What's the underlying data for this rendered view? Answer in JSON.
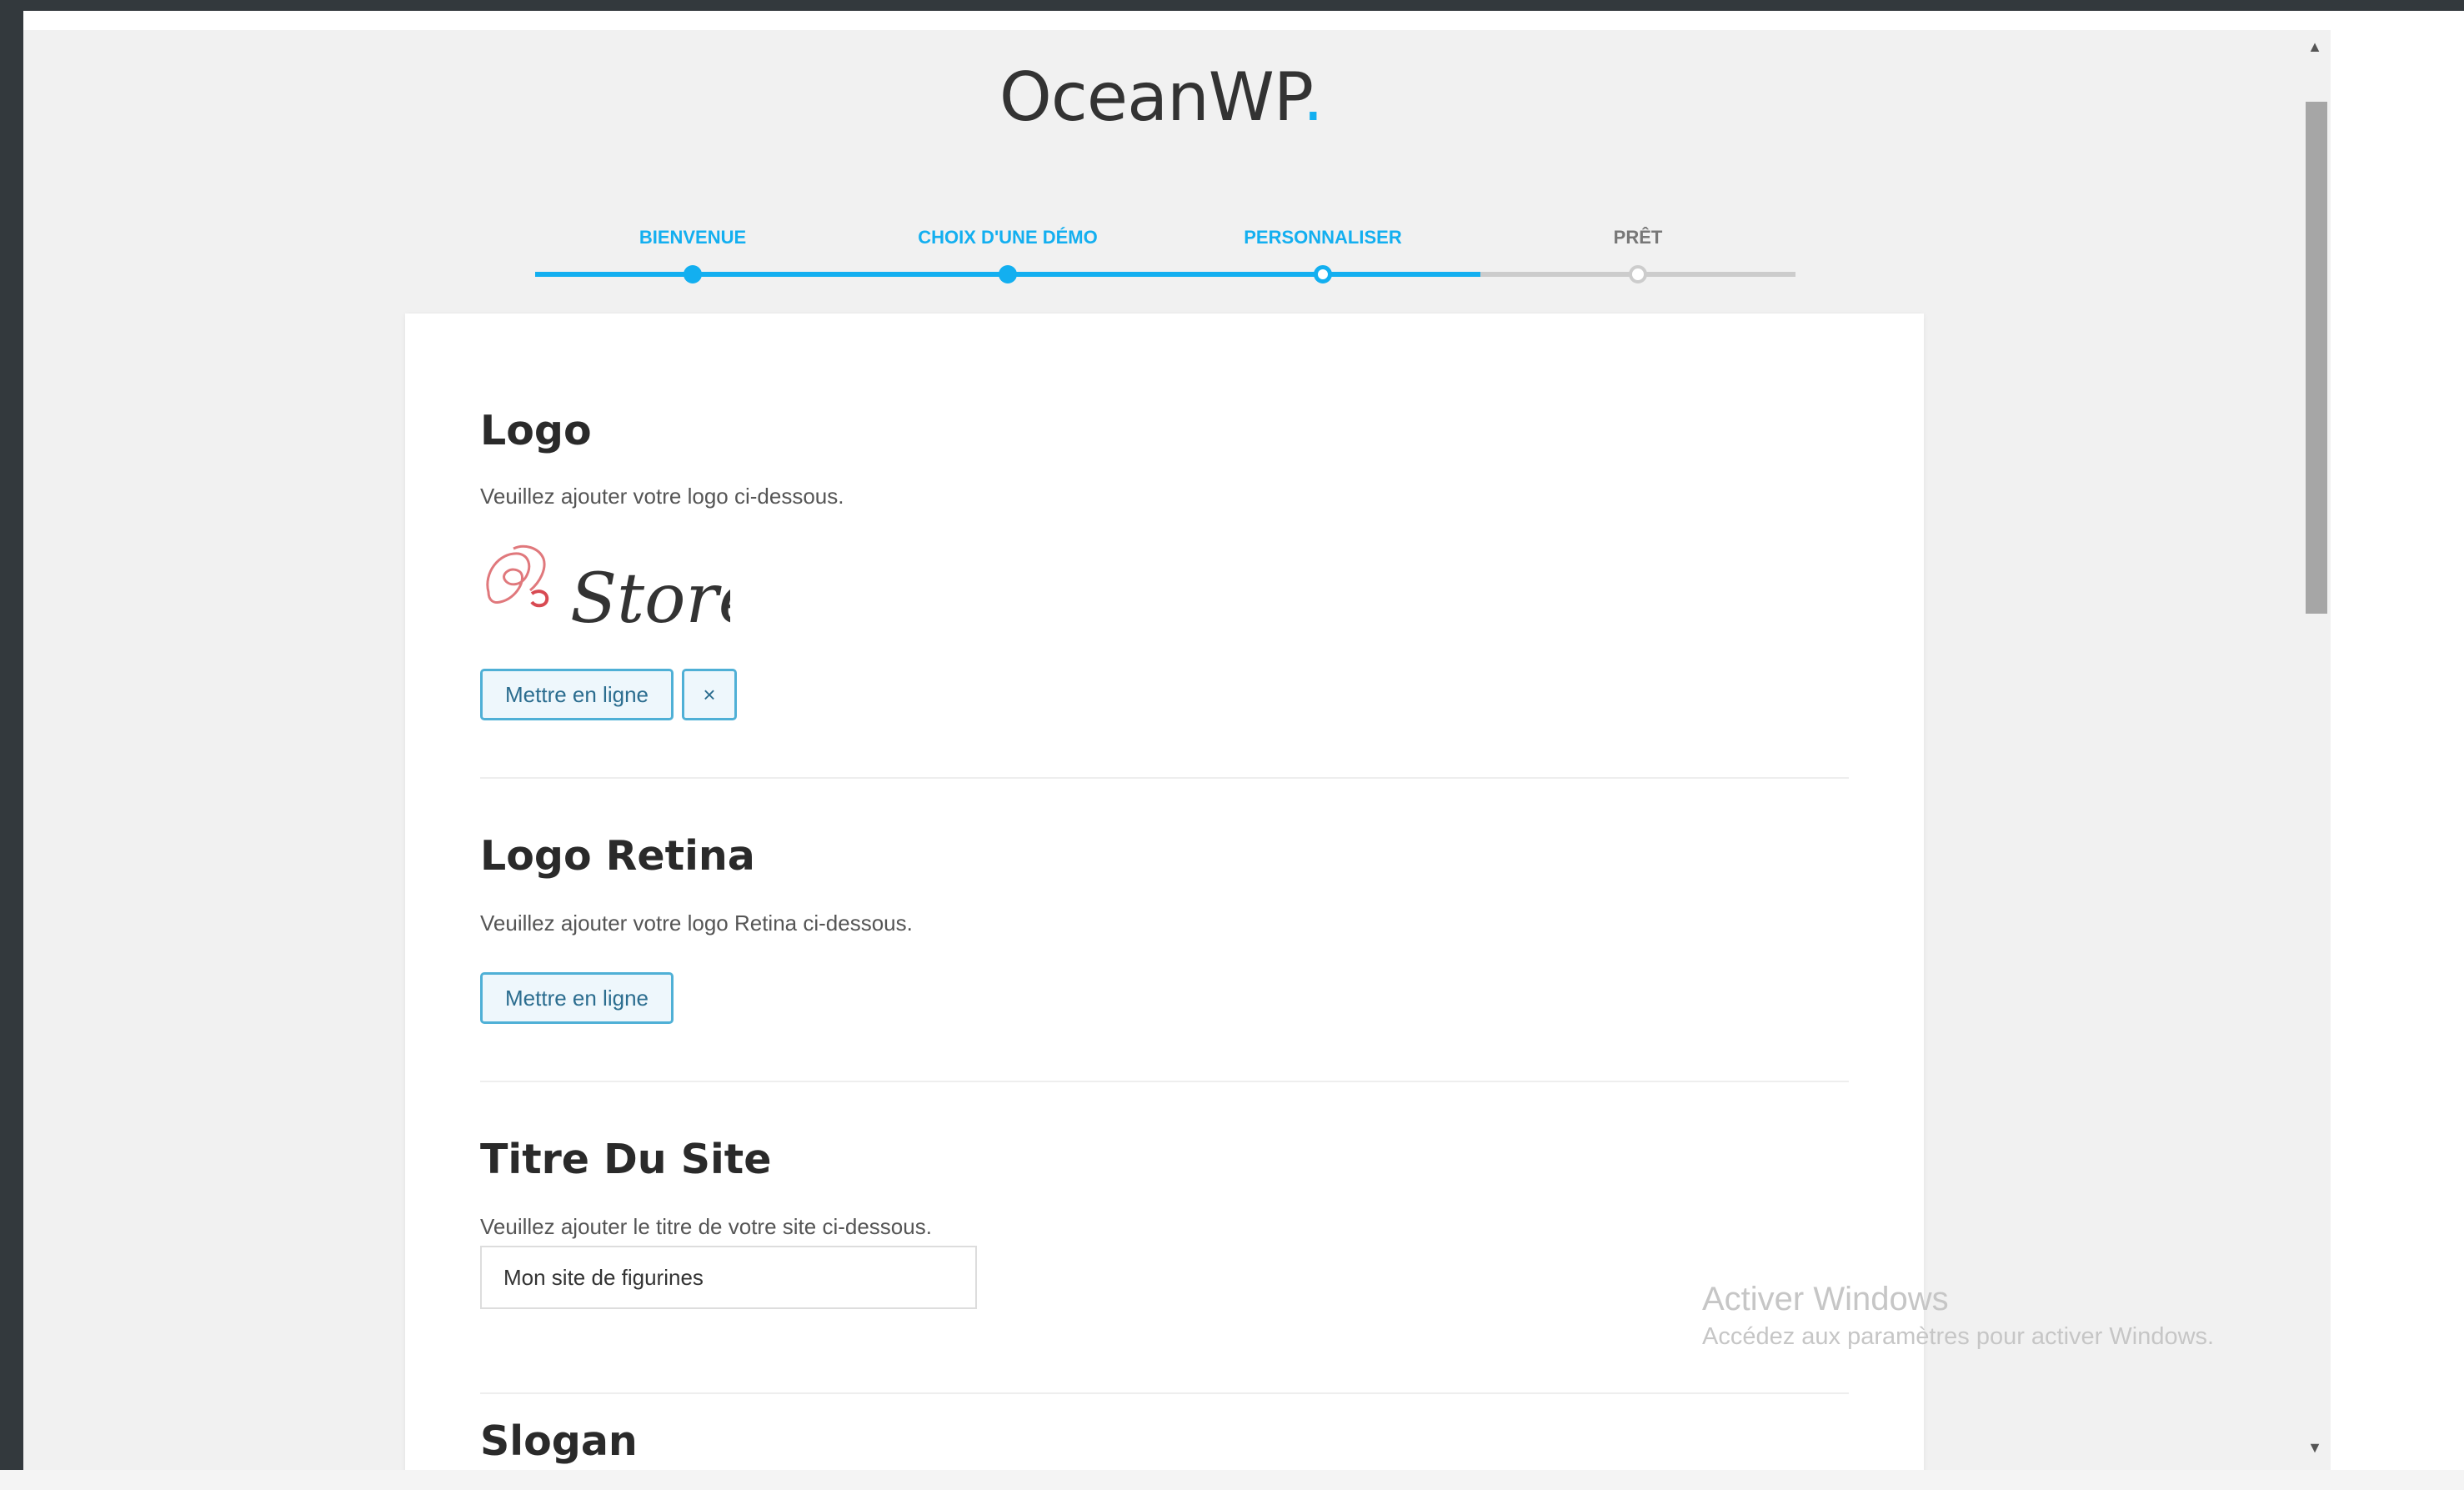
{
  "brand": {
    "name": "OceanWP",
    "dot": "."
  },
  "wizard": {
    "progress": 0.75,
    "steps": [
      {
        "label": "BIENVENUE",
        "state": "done"
      },
      {
        "label": "CHOIX D'UNE DÉMO",
        "state": "done"
      },
      {
        "label": "PERSONNALISER",
        "state": "current"
      },
      {
        "label": "PRÊT",
        "state": "pending"
      }
    ]
  },
  "sections": {
    "logo": {
      "title": "Logo",
      "description": "Veuillez ajouter votre logo ci-dessous.",
      "logo_text": "Store",
      "upload_label": "Mettre en ligne",
      "remove_label": "×"
    },
    "logo_retina": {
      "title": "Logo Retina",
      "description": "Veuillez ajouter votre logo Retina ci-dessous.",
      "upload_label": "Mettre en ligne"
    },
    "site_title": {
      "title": "Titre Du Site",
      "description": "Veuillez ajouter le titre de votre site ci-dessous.",
      "value": "Mon site de figurines"
    },
    "slogan": {
      "title": "Slogan"
    }
  },
  "watermark": {
    "title": "Activer Windows",
    "subtitle": "Accédez aux paramètres pour activer Windows."
  },
  "scrollbar": {
    "up_glyph": "▲",
    "down_glyph": "▼"
  },
  "colors": {
    "accent": "#13aff0",
    "track": "#cccccc"
  },
  "icons": {
    "remove": "close-icon",
    "scroll_up": "arrow-up-icon",
    "scroll_down": "arrow-down-icon"
  }
}
